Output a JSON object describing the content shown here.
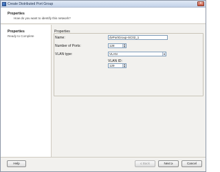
{
  "window": {
    "title": "Create Distributed Port Group",
    "close_glyph": "×"
  },
  "header": {
    "title": "Properties",
    "subtitle": "How do you want to identify this network?"
  },
  "sidebar": {
    "items": [
      {
        "label": "Properties",
        "state": "active"
      },
      {
        "label": "Ready to Complete",
        "state": "pending"
      }
    ]
  },
  "form": {
    "group_label": "Properties",
    "name_label": "Name:",
    "name_value": "dvPortGroup-SC02_1",
    "ports_label": "Number of Ports:",
    "ports_value": "128",
    "vlan_type_label": "VLAN type:",
    "vlan_type_value": "VLAN",
    "vlan_id_label": "VLAN ID:",
    "vlan_id_value": "129"
  },
  "footer": {
    "help_label": "Help",
    "back_label": "≤ Back",
    "next_label": "Next ≥",
    "cancel_label": "Cancel"
  },
  "colors": {
    "titlebar": "#c3d2e8",
    "panel": "#f2f1ee",
    "input_border": "#7f9db9"
  },
  "icons": {
    "app": "port-group-icon",
    "close": "close-icon",
    "spinner": "spinner-arrows-icon",
    "dropdown": "chevron-down-icon"
  }
}
